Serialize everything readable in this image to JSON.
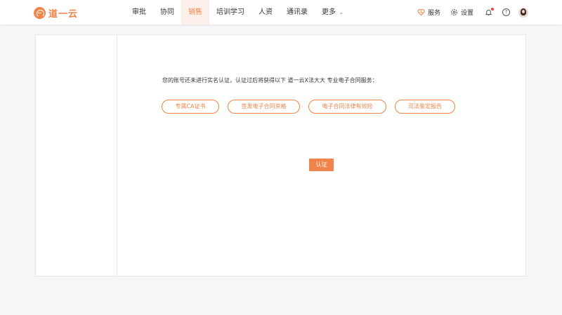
{
  "brand": {
    "logo_text": "道一云",
    "accent": "#f0844a"
  },
  "nav": {
    "items": [
      {
        "label": "审批"
      },
      {
        "label": "协同"
      },
      {
        "label": "销售"
      },
      {
        "label": "培训学习"
      },
      {
        "label": "人资"
      },
      {
        "label": "通讯录"
      },
      {
        "label": "更多"
      }
    ],
    "active": "销售"
  },
  "tools": {
    "service_label": "服务",
    "settings_label": "设置",
    "help_glyph": "?"
  },
  "main": {
    "notice": "您的账号还未进行实名认证，认证过后将获得以下 道一云X法大大 专业电子合同服务：",
    "features": [
      {
        "label": "专属CA证书"
      },
      {
        "label": "签发电子合同资格"
      },
      {
        "label": "电子合同法律有效险"
      },
      {
        "label": "司法鉴定报告"
      }
    ],
    "auth_button": "认证"
  }
}
